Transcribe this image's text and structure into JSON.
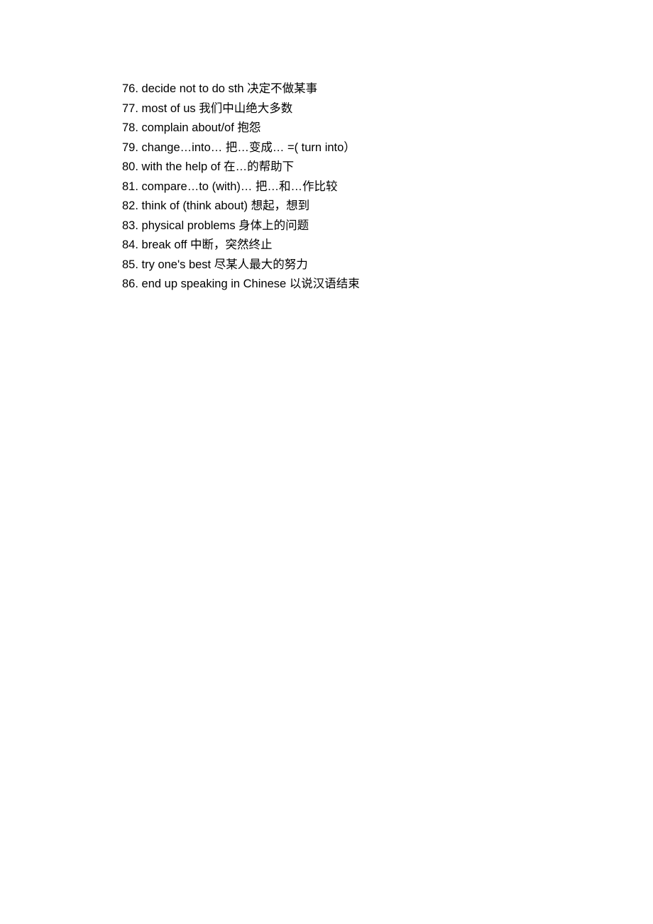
{
  "entries": [
    {
      "num": "76.",
      "en": "decide not to do sth ",
      "zh": "决定不做某事"
    },
    {
      "num": "77.",
      "en": "most of us ",
      "zh": "我们中山绝大多数"
    },
    {
      "num": "78.",
      "en": "complain about/of ",
      "zh": "抱怨"
    },
    {
      "num": "79.",
      "en": "change…into…",
      "zh": "把…变成… =( turn into）"
    },
    {
      "num": "80.",
      "en": "with the help of ",
      "zh": "在…的帮助下"
    },
    {
      "num": "81.",
      "en": "compare…to (with)… ",
      "zh": "把…和…作比较"
    },
    {
      "num": "82.",
      "en": "think of (think about) ",
      "zh": "想起，想到"
    },
    {
      "num": "83.",
      "en": "physical problems ",
      "zh": "身体上的问题"
    },
    {
      "num": "84.",
      "en": "break off ",
      "zh": "中断，突然终止"
    },
    {
      "num": "85.",
      "en": "try one's best ",
      "zh": "尽某人最大的努力"
    },
    {
      "num": "86.",
      "en": "end up speaking in Chinese ",
      "zh": "以说汉语结束"
    }
  ]
}
